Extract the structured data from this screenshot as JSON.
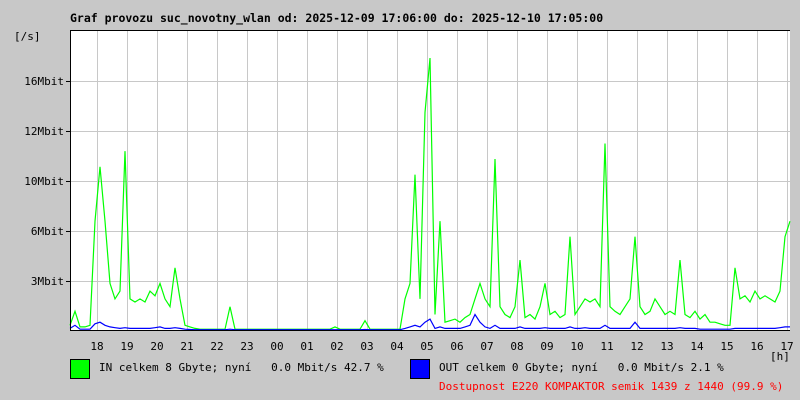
{
  "chart_data": {
    "type": "line",
    "title": "Graf provozu suc_novotny_wlan od: 2025-12-09 17:06:00 do: 2025-12-10 17:05:00",
    "ylabel": "[/s]",
    "xlabel": "[h]",
    "y_ticks": [
      "3Mbit",
      "6Mbit",
      "10Mbit",
      "12Mbit",
      "16Mbit"
    ],
    "x_ticks": [
      "18",
      "19",
      "20",
      "21",
      "22",
      "23",
      "00",
      "01",
      "02",
      "03",
      "04",
      "05",
      "06",
      "07",
      "08",
      "09",
      "10",
      "11",
      "12",
      "13",
      "14",
      "15",
      "16",
      "17"
    ],
    "ylim_mbit": [
      0,
      19.3
    ],
    "sample_interval_minutes": 10,
    "grid": true,
    "series": [
      {
        "name": "IN",
        "color": "#00ff00",
        "unit": "Mbit/s",
        "values": [
          0.3,
          1.2,
          0.2,
          0.2,
          0.3,
          7,
          10.5,
          7,
          3,
          2,
          2.5,
          11.5,
          2,
          1.8,
          2,
          1.8,
          2.5,
          2.2,
          3,
          2,
          1.5,
          4,
          2,
          0.3,
          0.2,
          0.1,
          0.05,
          0.05,
          0.05,
          0.05,
          0.05,
          0.05,
          1.5,
          0.05,
          0.05,
          0.05,
          0.05,
          0.05,
          0.05,
          0.05,
          0.05,
          0.05,
          0.05,
          0.05,
          0.05,
          0.05,
          0.05,
          0.05,
          0.05,
          0.05,
          0.05,
          0.05,
          0.05,
          0.2,
          0.05,
          0.05,
          0.05,
          0.05,
          0.05,
          0.6,
          0.05,
          0.05,
          0.05,
          0.05,
          0.05,
          0.05,
          0.05,
          2,
          3,
          10,
          2,
          14,
          17.5,
          1,
          7,
          0.5,
          0.6,
          0.7,
          0.5,
          0.8,
          1,
          2,
          3,
          2,
          1.5,
          11,
          1.5,
          1,
          0.8,
          1.5,
          4.5,
          0.8,
          1,
          0.7,
          1.5,
          3,
          1,
          1.2,
          0.8,
          1,
          6,
          1,
          1.5,
          2,
          1.8,
          2,
          1.5,
          12,
          1.5,
          1.2,
          1,
          1.5,
          2,
          6,
          1.5,
          1,
          1.2,
          2,
          1.5,
          1,
          1.2,
          1,
          4.5,
          1,
          0.8,
          1.2,
          0.7,
          1,
          0.5,
          0.5,
          0.4,
          0.3,
          0.3,
          4,
          2,
          2.2,
          1.8,
          2.5,
          2,
          2.2,
          2,
          1.8,
          2.5,
          6,
          7
        ]
      },
      {
        "name": "OUT",
        "color": "#0000ff",
        "unit": "Mbit/s",
        "values": [
          0.1,
          0.3,
          0.05,
          0.05,
          0.05,
          0.4,
          0.5,
          0.3,
          0.2,
          0.15,
          0.1,
          0.15,
          0.1,
          0.1,
          0.1,
          0.1,
          0.1,
          0.15,
          0.2,
          0.1,
          0.1,
          0.15,
          0.1,
          0.05,
          0.03,
          0.02,
          0.02,
          0.02,
          0.02,
          0.02,
          0.02,
          0.02,
          0.05,
          0.02,
          0.02,
          0.02,
          0.02,
          0.02,
          0.02,
          0.02,
          0.02,
          0.02,
          0.02,
          0.02,
          0.02,
          0.02,
          0.02,
          0.02,
          0.02,
          0.02,
          0.02,
          0.02,
          0.02,
          0.02,
          0.02,
          0.02,
          0.02,
          0.02,
          0.02,
          0.03,
          0.02,
          0.02,
          0.02,
          0.02,
          0.02,
          0.02,
          0.02,
          0.1,
          0.2,
          0.3,
          0.2,
          0.5,
          0.7,
          0.1,
          0.2,
          0.1,
          0.1,
          0.1,
          0.1,
          0.2,
          0.3,
          1,
          0.5,
          0.2,
          0.1,
          0.3,
          0.1,
          0.1,
          0.1,
          0.1,
          0.2,
          0.1,
          0.1,
          0.1,
          0.1,
          0.15,
          0.1,
          0.1,
          0.1,
          0.1,
          0.2,
          0.1,
          0.1,
          0.15,
          0.1,
          0.1,
          0.1,
          0.3,
          0.1,
          0.1,
          0.1,
          0.1,
          0.1,
          0.5,
          0.1,
          0.1,
          0.1,
          0.1,
          0.1,
          0.1,
          0.1,
          0.1,
          0.15,
          0.1,
          0.1,
          0.1,
          0.05,
          0.05,
          0.05,
          0.05,
          0.05,
          0.05,
          0.05,
          0.1,
          0.1,
          0.1,
          0.1,
          0.1,
          0.1,
          0.1,
          0.1,
          0.1,
          0.15,
          0.2,
          0.2
        ]
      }
    ]
  },
  "legend": {
    "in_text": "IN celkem 8 Gbyte; nyní   0.0 Mbit/s 42.7 %",
    "out_text": "OUT celkem 0 Gbyte; nyní   0.0 Mbit/s 2.1 %",
    "availability": "Dostupnost E220 KOMPAKTOR semik 1439 z 1440 (99.9 %)",
    "availability_color": "#ff0000"
  }
}
